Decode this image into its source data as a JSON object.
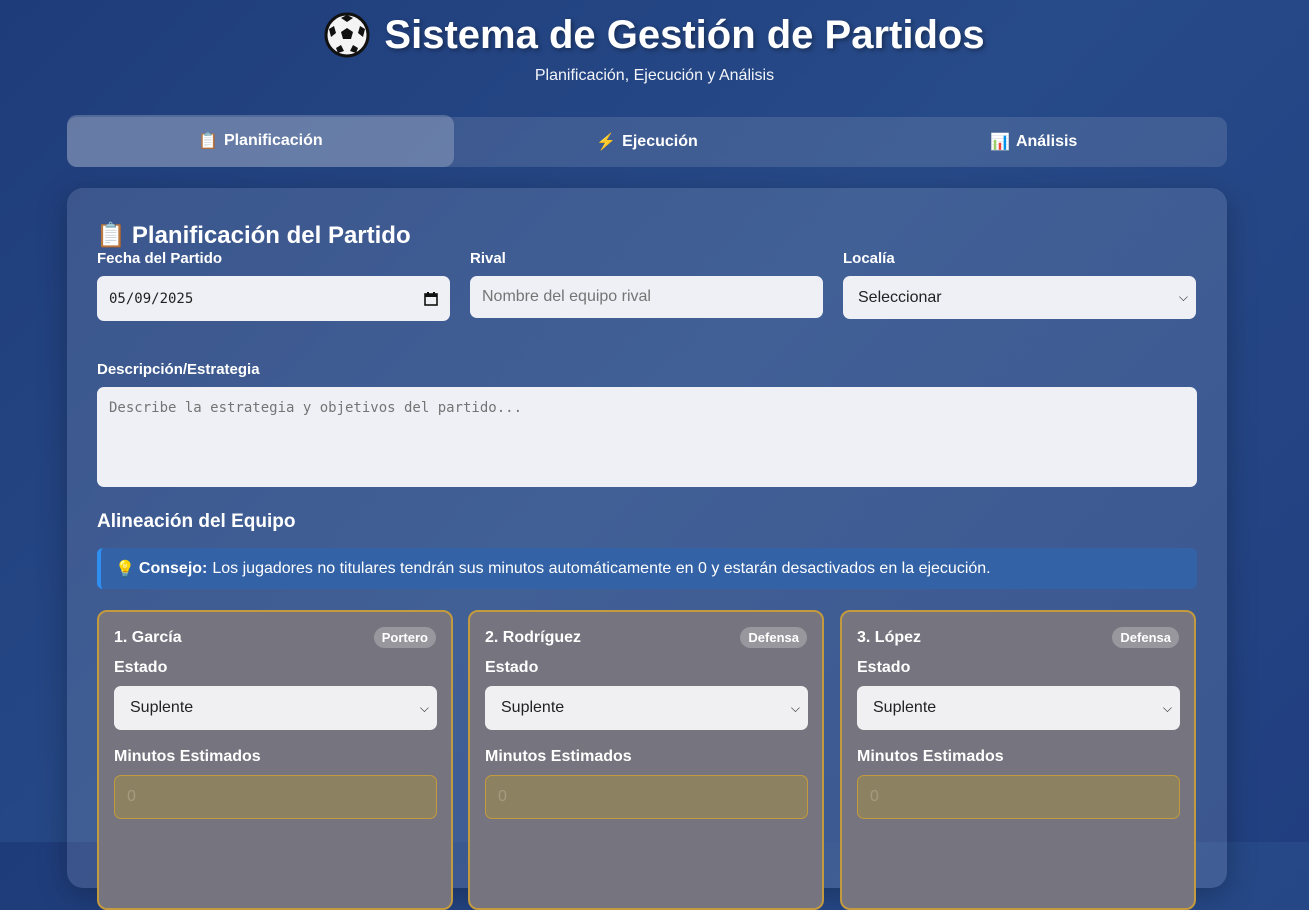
{
  "header": {
    "title": "Sistema de Gestión de Partidos",
    "subtitle": "Planificación, Ejecución y Análisis"
  },
  "tabs": [
    {
      "icon": "📋",
      "label": "Planificación",
      "active": true
    },
    {
      "icon": "⚡",
      "label": "Ejecución",
      "active": false
    },
    {
      "icon": "📊",
      "label": "Análisis",
      "active": false
    }
  ],
  "planning": {
    "title": "Planificación del Partido",
    "title_icon": "📋",
    "date_label": "Fecha del Partido",
    "date_value": "05/09/2025",
    "rival_label": "Rival",
    "rival_placeholder": "Nombre del equipo rival",
    "locality_label": "Localía",
    "locality_value": "Seleccionar",
    "description_label": "Descripción/Estrategia",
    "description_placeholder": "Describe la estrategia y objetivos del partido...",
    "lineup_title": "Alineación del Equipo",
    "tip_icon": "💡",
    "tip_bold": "Consejo:",
    "tip_text": "Los jugadores no titulares tendrán sus minutos automáticamente en 0 y estarán desactivados en la ejecución."
  },
  "players": [
    {
      "name": "1. García",
      "position": "Portero",
      "estado_label": "Estado",
      "estado_value": "Suplente",
      "minutes_label": "Minutos Estimados",
      "minutes_value": "0"
    },
    {
      "name": "2. Rodríguez",
      "position": "Defensa",
      "estado_label": "Estado",
      "estado_value": "Suplente",
      "minutes_label": "Minutos Estimados",
      "minutes_value": "0"
    },
    {
      "name": "3. López",
      "position": "Defensa",
      "estado_label": "Estado",
      "estado_value": "Suplente",
      "minutes_label": "Minutos Estimados",
      "minutes_value": "0"
    }
  ]
}
